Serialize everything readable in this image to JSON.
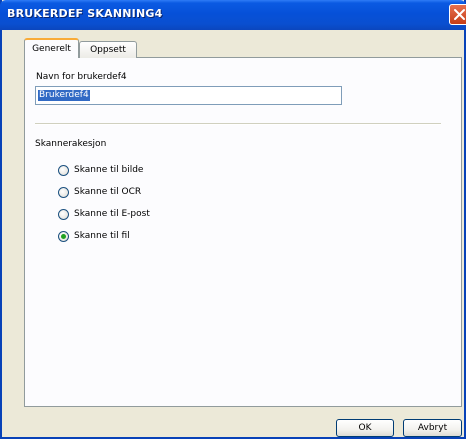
{
  "window": {
    "title": "BRUKERDEF SKANNING4"
  },
  "tabs": [
    {
      "label": "Generelt",
      "active": true
    },
    {
      "label": "Oppsett",
      "active": false
    }
  ],
  "general": {
    "name_label": "Navn for brukerdef4",
    "name_value": "Brukerdef4",
    "scan_action_label": "Skannerakesjon",
    "scan_options": [
      {
        "label": "Skanne til bilde",
        "selected": false
      },
      {
        "label": "Skanne til OCR",
        "selected": false
      },
      {
        "label": "Skanne til E-post",
        "selected": false
      },
      {
        "label": "Skanne til fil",
        "selected": true
      }
    ]
  },
  "buttons": {
    "ok": "OK",
    "cancel": "Avbryt"
  }
}
